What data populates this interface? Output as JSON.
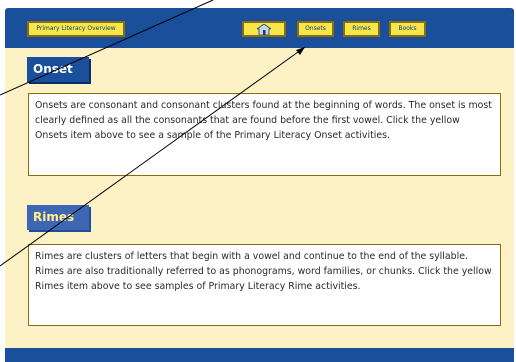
{
  "toolbar": {
    "overview_label": "Primary Literacy Overview",
    "home_icon": "house-icon",
    "onsets_label": "Onsets",
    "rimes_label": "Rimes",
    "books_label": "Books"
  },
  "onset": {
    "heading": "Onset",
    "body": "Onsets are consonant and consonant clusters found at the beginning of words. The onset is most clearly defined as all the consonants that are found before the first vowel. Click the yellow Onsets item above to see a sample of the Primary Literacy Onset activities."
  },
  "rimes": {
    "heading": "Rimes",
    "body": "Rimes are clusters of letters that begin with a vowel and continue to the end of the syllable. Rimes are also traditionally referred to as phonograms, word families, or chunks. Click the yellow Rimes item above to see samples of Primary Literacy Rime activities."
  },
  "colors": {
    "bar_blue": "#1a4f9c",
    "panel_cream": "#fdf2c6",
    "button_yellow": "#f5e64a"
  }
}
